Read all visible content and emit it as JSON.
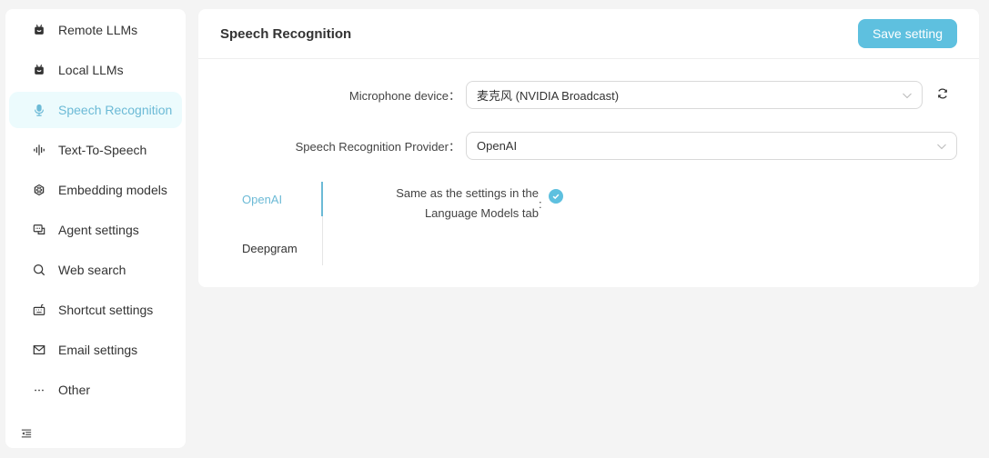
{
  "sidebar": {
    "items": [
      {
        "label": "Remote LLMs",
        "icon": "robot-icon"
      },
      {
        "label": "Local LLMs",
        "icon": "robot-icon"
      },
      {
        "label": "Speech Recognition",
        "icon": "microphone-icon",
        "active": true
      },
      {
        "label": "Text-To-Speech",
        "icon": "sound-wave-icon"
      },
      {
        "label": "Embedding models",
        "icon": "cube-network-icon"
      },
      {
        "label": "Agent settings",
        "icon": "chat-bubbles-icon"
      },
      {
        "label": "Web search",
        "icon": "search-icon"
      },
      {
        "label": "Shortcut settings",
        "icon": "keyboard-icon"
      },
      {
        "label": "Email settings",
        "icon": "mail-icon"
      },
      {
        "label": "Other",
        "icon": "ellipsis-icon"
      }
    ],
    "collapse_icon": "menu-fold-icon"
  },
  "main": {
    "title": "Speech Recognition",
    "save_label": "Save setting",
    "microphone": {
      "label": "Microphone device：",
      "value": "麦克风 (NVIDIA Broadcast)"
    },
    "provider": {
      "label": "Speech Recognition Provider：",
      "value": "OpenAI"
    },
    "tabs": [
      {
        "label": "OpenAI",
        "active": true
      },
      {
        "label": "Deepgram",
        "active": false
      }
    ],
    "same_settings": {
      "label_line1": "Same as the settings in the",
      "label_line2": "Language Models tab",
      "colon": ":",
      "checked": true
    }
  },
  "colors": {
    "accent": "#5ec0df",
    "active_text": "#6cbad6",
    "active_bg": "#ecfbfd"
  }
}
